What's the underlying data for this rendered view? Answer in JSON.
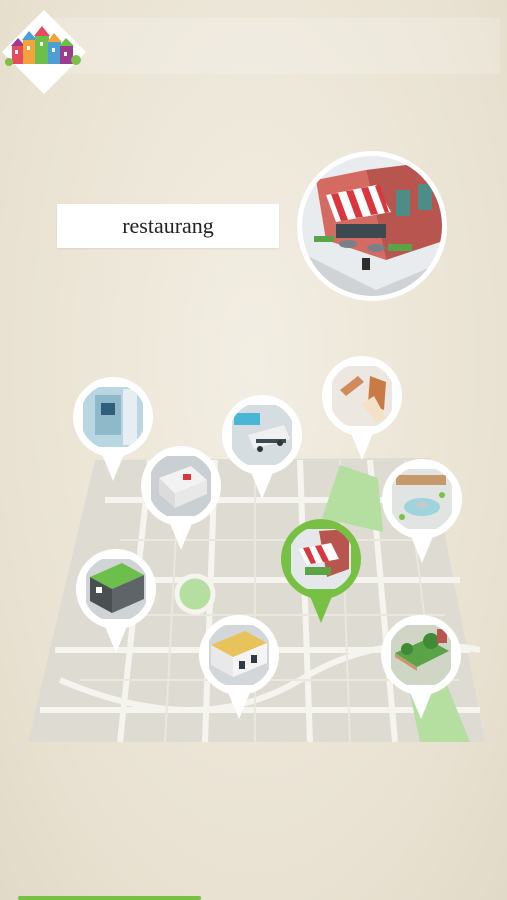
{
  "prompt": {
    "word": "restaurang"
  },
  "target": {
    "icon": "restaurant-icon"
  },
  "home": {
    "icon": "houses-icon"
  },
  "pins": [
    {
      "id": "atm",
      "icon": "atm-icon",
      "selected": false
    },
    {
      "id": "hospital",
      "icon": "hospital-icon",
      "selected": false
    },
    {
      "id": "bus-station",
      "icon": "bus-icon",
      "selected": false
    },
    {
      "id": "playground",
      "icon": "slide-icon",
      "selected": false
    },
    {
      "id": "pharmacy",
      "icon": "pharmacy-icon",
      "selected": false
    },
    {
      "id": "restaurant",
      "icon": "restaurant-icon",
      "selected": true
    },
    {
      "id": "square",
      "icon": "fountain-icon",
      "selected": false
    },
    {
      "id": "train-station",
      "icon": "train-icon",
      "selected": false
    },
    {
      "id": "park",
      "icon": "park-icon",
      "selected": false
    }
  ],
  "progress": {
    "fraction": 0.36
  },
  "colors": {
    "accent": "#78c043",
    "pin": "#ffffff",
    "map": "#dedbd3",
    "park": "#b5dfa0"
  }
}
